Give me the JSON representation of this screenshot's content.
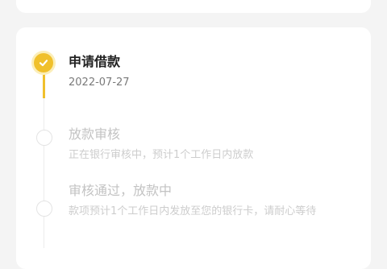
{
  "steps": [
    {
      "title": "申请借款",
      "desc": "2022-07-27",
      "status": "done"
    },
    {
      "title": "放款审核",
      "desc": "正在银行审核中，预计1个工作日内放款",
      "status": "pending"
    },
    {
      "title": "审核通过，放款中",
      "desc": "款项预计1个工作日内发放至您的银行卡，请耐心等待",
      "status": "pending"
    }
  ],
  "colors": {
    "accent": "#f0c02c",
    "accent_light": "#fbeeb9",
    "muted_text": "#c3c3c3"
  },
  "icons": {
    "done": "check-icon"
  }
}
